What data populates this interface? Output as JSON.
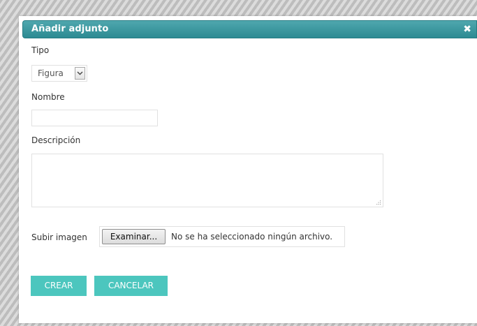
{
  "dialog": {
    "title": "Añadir adjunto",
    "close_symbol": "✖"
  },
  "form": {
    "tipo_label": "Tipo",
    "tipo_value": "Figura",
    "nombre_label": "Nombre",
    "nombre_value": "",
    "descripcion_label": "Descripción",
    "descripcion_value": "",
    "subir_label": "Subir imagen",
    "browse_label": "Examinar...",
    "file_status": "No se ha seleccionado ningún archivo."
  },
  "buttons": {
    "create": "CREAR",
    "cancel": "CANCELAR"
  },
  "colors": {
    "titlebar": "#3d98a0",
    "button": "#4cc6be"
  },
  "icons": {
    "close": "close-icon",
    "dropdown": "chevron-down-icon",
    "resize": "resize-grip-icon"
  }
}
